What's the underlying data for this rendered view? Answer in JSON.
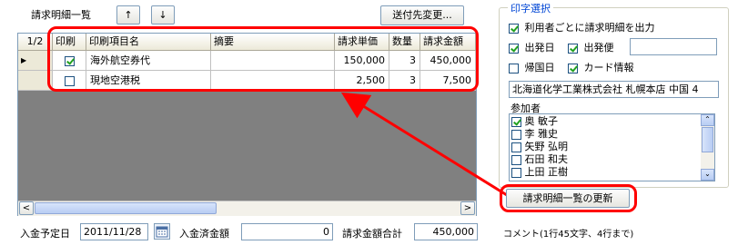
{
  "toolbar": {
    "title": "請求明細一覧",
    "up_arrow": "↑",
    "down_arrow": "↓",
    "dest_button": "送付先変更..."
  },
  "grid": {
    "row_counter": "1/2",
    "headers": [
      "印刷",
      "印刷項目名",
      "摘要",
      "請求単価",
      "数量",
      "請求金額"
    ],
    "rows": [
      {
        "indicator": "▶",
        "print": true,
        "name": "海外航空券代",
        "summary": "",
        "unit_price": "150,000",
        "qty": "3",
        "amount": "450,000"
      },
      {
        "indicator": "",
        "print": false,
        "name": "現地空港税",
        "summary": "",
        "unit_price": "2,500",
        "qty": "3",
        "amount": "7,500"
      }
    ],
    "hscroll_left": "<",
    "hscroll_right": ">"
  },
  "footer": {
    "due_date_label": "入金予定日",
    "due_date_value": "2011/11/28",
    "paid_label": "入金済金額",
    "paid_value": "0",
    "total_label": "請求金額合計",
    "total_value": "450,000",
    "comment_hint": "コメント(1行45文字、4行まで)"
  },
  "print_panel": {
    "title": "印字選択",
    "per_user": {
      "label": "利用者ごとに請求明細を出力",
      "checked": true
    },
    "departure_date": {
      "label": "出発日",
      "checked": true
    },
    "departure_flight": {
      "label": "出発便",
      "checked": true
    },
    "return_date": {
      "label": "帰国日",
      "checked": false
    },
    "card_info": {
      "label": "カード情報",
      "checked": true
    },
    "company_field": "北海道化学工業株式会社 札幌本店 中国 4",
    "participants_label": "参加者",
    "participants": [
      {
        "name": "奥 敏子",
        "checked": true
      },
      {
        "name": "李 雅史",
        "checked": false
      },
      {
        "name": "矢野 弘明",
        "checked": false
      },
      {
        "name": "石田 和夫",
        "checked": false
      },
      {
        "name": "上田 正樹",
        "checked": false
      }
    ],
    "update_button": "請求明細一覧の更新"
  },
  "colors": {
    "highlight": "#ff0000",
    "grid_empty": "#808080",
    "check": "#21a121"
  }
}
